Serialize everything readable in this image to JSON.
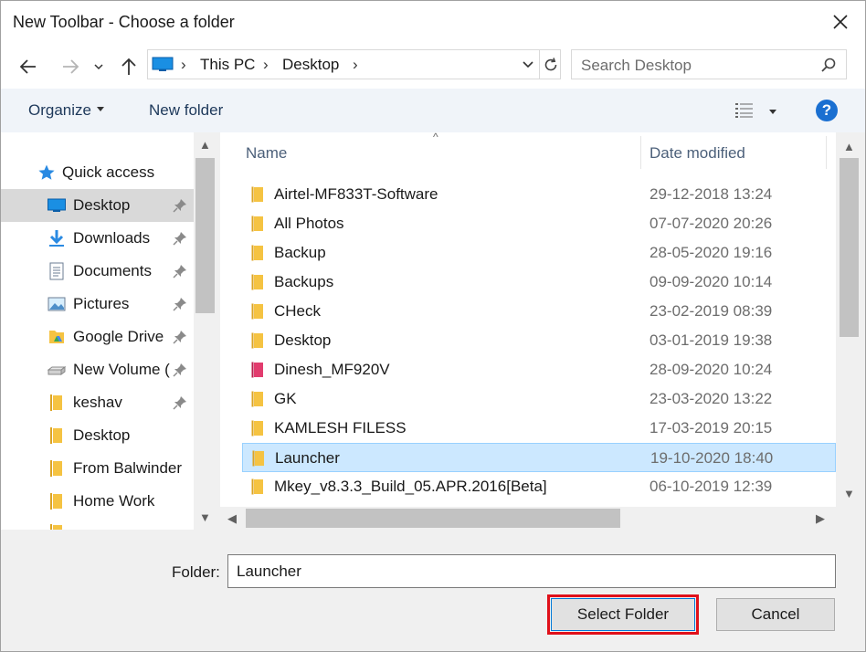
{
  "window": {
    "title": "New Toolbar - Choose a folder"
  },
  "address": {
    "segments": [
      "This PC",
      "Desktop"
    ]
  },
  "search": {
    "placeholder": "Search Desktop"
  },
  "toolbar": {
    "organize_label": "Organize",
    "new_folder_label": "New folder",
    "help_label": "?"
  },
  "nav": {
    "items": [
      {
        "label": "Quick access",
        "icon": "star-icon",
        "pinned": false
      },
      {
        "label": "Desktop",
        "icon": "desktop-icon",
        "pinned": true,
        "selected": true
      },
      {
        "label": "Downloads",
        "icon": "download-arrow-icon",
        "pinned": true
      },
      {
        "label": "Documents",
        "icon": "document-icon",
        "pinned": true
      },
      {
        "label": "Pictures",
        "icon": "pictures-icon",
        "pinned": true
      },
      {
        "label": "Google Drive",
        "icon": "google-drive-folder-icon",
        "pinned": true
      },
      {
        "label": "New Volume (",
        "icon": "drive-icon",
        "pinned": true
      },
      {
        "label": "keshav",
        "icon": "folder-icon",
        "pinned": true
      },
      {
        "label": "Desktop",
        "icon": "folder-icon",
        "pinned": false
      },
      {
        "label": "From Balwinder",
        "icon": "folder-icon",
        "pinned": false
      },
      {
        "label": "Home Work",
        "icon": "folder-icon",
        "pinned": false
      }
    ]
  },
  "files": {
    "columns": {
      "name": "Name",
      "date": "Date modified"
    },
    "rows": [
      {
        "name": "Airtel-MF833T-Software",
        "date": "29-12-2018 13:24",
        "icon": "folder-icon"
      },
      {
        "name": "All Photos",
        "date": "07-07-2020 20:26",
        "icon": "folder-icon"
      },
      {
        "name": "Backup",
        "date": "28-05-2020 19:16",
        "icon": "folder-icon"
      },
      {
        "name": "Backups",
        "date": "09-09-2020 10:14",
        "icon": "folder-icon"
      },
      {
        "name": "CHeck",
        "date": "23-02-2019 08:39",
        "icon": "folder-icon"
      },
      {
        "name": "Desktop",
        "date": "03-01-2019 19:38",
        "icon": "folder-icon"
      },
      {
        "name": "Dinesh_MF920V",
        "date": "28-09-2020 10:24",
        "icon": "pink-folder-icon"
      },
      {
        "name": "GK",
        "date": "23-03-2020 13:22",
        "icon": "folder-icon"
      },
      {
        "name": "KAMLESH FILESS",
        "date": "17-03-2019 20:15",
        "icon": "folder-icon"
      },
      {
        "name": "Launcher",
        "date": "19-10-2020 18:40",
        "icon": "folder-icon",
        "selected": true
      },
      {
        "name": "Mkey_v8.3.3_Build_05.APR.2016[Beta]",
        "date": "06-10-2019 12:39",
        "icon": "folder-icon"
      }
    ]
  },
  "bottom": {
    "folder_label": "Folder:",
    "folder_value": "Launcher",
    "select_label": "Select Folder",
    "cancel_label": "Cancel"
  },
  "colors": {
    "accent": "#0078d7",
    "highlight_outline": "#e0101a",
    "selection": "#cce8ff",
    "folder": "#f5c342"
  }
}
